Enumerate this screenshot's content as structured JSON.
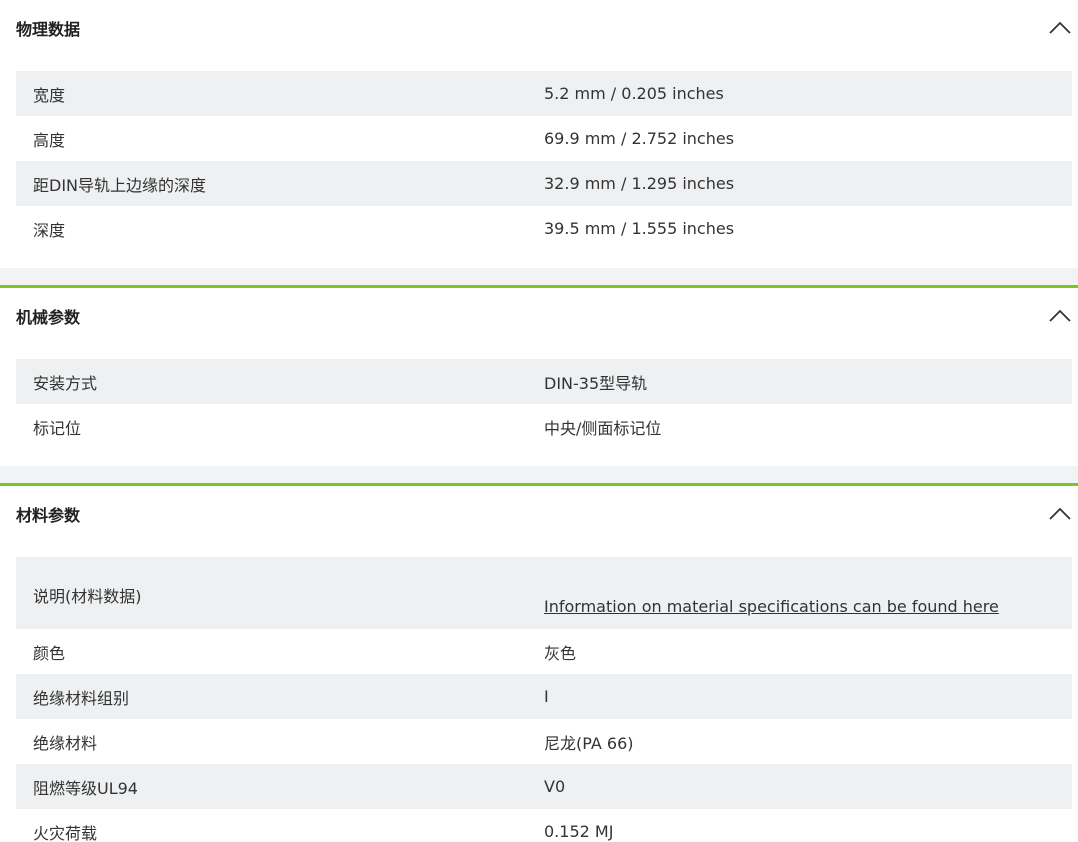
{
  "sections": [
    {
      "title": "物理数据",
      "rows": [
        {
          "label": "宽度",
          "value": "5.2 mm / 0.205 inches"
        },
        {
          "label": "高度",
          "value": "69.9 mm / 2.752 inches"
        },
        {
          "label": "距DIN导轨上边缘的深度",
          "value": "32.9 mm / 1.295 inches"
        },
        {
          "label": "深度",
          "value": "39.5 mm / 1.555 inches"
        }
      ]
    },
    {
      "title": "机械参数",
      "rows": [
        {
          "label": "安装方式",
          "value": "DIN-35型导轨"
        },
        {
          "label": "标记位",
          "value": "中央/侧面标记位"
        }
      ]
    },
    {
      "title": "材料参数",
      "rows": [
        {
          "label": "说明(材料数据)",
          "value": "Information on material specifications can be found here"
        },
        {
          "label": "颜色",
          "value": "灰色"
        },
        {
          "label": "绝缘材料组别",
          "value": "I"
        },
        {
          "label": "绝缘材料",
          "value": "尼龙(PA 66)"
        },
        {
          "label": "阻燃等级UL94",
          "value": "V0"
        },
        {
          "label": "火灾荷载",
          "value": "0.152 MJ"
        }
      ]
    }
  ],
  "icons": {
    "collapse": "chevron-up-icon"
  },
  "colors": {
    "divider": "#79c71f",
    "row_shade": "#eef0f2"
  }
}
